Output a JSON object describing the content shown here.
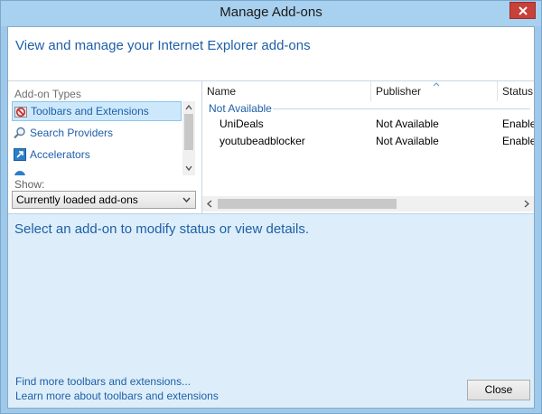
{
  "window": {
    "title": "Manage Add-ons"
  },
  "header": {
    "text": "View and manage your Internet Explorer add-ons"
  },
  "sidebar": {
    "types_label": "Add-on Types",
    "items": [
      {
        "label": "Toolbars and Extensions",
        "icon": "toolbars-icon",
        "selected": true
      },
      {
        "label": "Search Providers",
        "icon": "search-icon",
        "selected": false
      },
      {
        "label": "Accelerators",
        "icon": "accelerators-icon",
        "selected": false
      }
    ],
    "show_label": "Show:",
    "show_value": "Currently loaded add-ons"
  },
  "list": {
    "columns": [
      "Name",
      "Publisher",
      "Status"
    ],
    "group": "Not Available",
    "rows": [
      {
        "name": "UniDeals",
        "publisher": "Not Available",
        "status": "Enabled"
      },
      {
        "name": "youtubeadblocker",
        "publisher": "Not Available",
        "status": "Enabled"
      }
    ]
  },
  "details": {
    "text": "Select an add-on to modify status or view details."
  },
  "footer": {
    "link1": "Find more toolbars and extensions...",
    "link2": "Learn more about toolbars and extensions",
    "close_label": "Close"
  },
  "colors": {
    "accent": "#1e5fa8",
    "selection": "#cde8fb",
    "details_bg": "#ddeefa",
    "close_red": "#c7403a"
  }
}
